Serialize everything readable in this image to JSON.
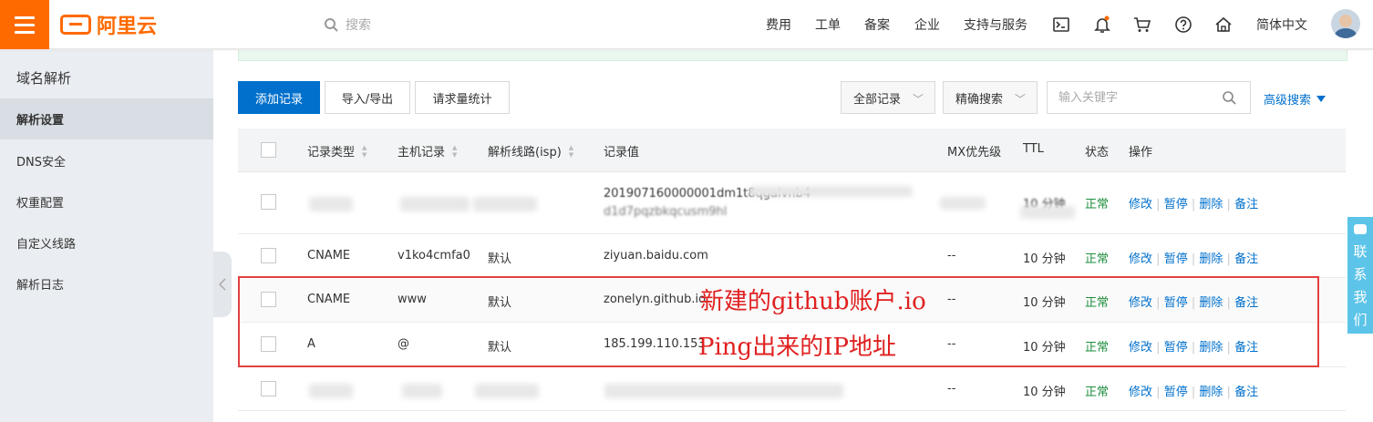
{
  "brand": {
    "name": "阿里云"
  },
  "header": {
    "search_placeholder": "搜索",
    "nav": [
      "费用",
      "工单",
      "备案",
      "企业",
      "支持与服务"
    ],
    "language": "简体中文"
  },
  "sidebar": {
    "title": "域名解析",
    "items": [
      {
        "label": "解析设置",
        "active": true
      },
      {
        "label": "DNS安全"
      },
      {
        "label": "权重配置"
      },
      {
        "label": "自定义线路"
      },
      {
        "label": "解析日志"
      }
    ]
  },
  "toolbar": {
    "add_label": "添加记录",
    "import_export_label": "导入/导出",
    "stats_label": "请求量统计",
    "filter_all": "全部记录",
    "filter_exact": "精确搜索",
    "keyword_placeholder": "输入关键字",
    "advanced_label": "高级搜索"
  },
  "table": {
    "headers": {
      "type": "记录类型",
      "host": "主机记录",
      "line": "解析线路(isp)",
      "value": "记录值",
      "mx": "MX优先级",
      "ttl": "TTL",
      "status": "状态",
      "ops": "操作"
    },
    "actions": {
      "edit": "修改",
      "pause": "暂停",
      "delete": "删除",
      "remark": "备注"
    },
    "rows": [
      {
        "type": "",
        "host": "",
        "line": "",
        "value": "201907160000001dm1t8qgalvnb4",
        "value2": "d1d7pqzbkqcusm9hl",
        "mx": "",
        "ttl": "10 分钟",
        "status": "正常"
      },
      {
        "type": "CNAME",
        "host": "v1ko4cmfa0",
        "line": "默认",
        "value": "ziyuan.baidu.com",
        "mx": "--",
        "ttl": "10 分钟",
        "status": "正常"
      },
      {
        "type": "CNAME",
        "host": "www",
        "line": "默认",
        "value": "zonelyn.github.io",
        "mx": "--",
        "ttl": "10 分钟",
        "status": "正常"
      },
      {
        "type": "A",
        "host": "@",
        "line": "默认",
        "value": "185.199.110.153",
        "mx": "--",
        "ttl": "10 分钟",
        "status": "正常"
      },
      {
        "type": "",
        "host": "",
        "line": "",
        "value": "",
        "mx": "--",
        "ttl": "10 分钟",
        "status": "正常"
      }
    ]
  },
  "annotations": {
    "note1": "新建的github账户.io",
    "note2": "Ping出来的IP地址"
  },
  "contact": {
    "label_chars": [
      "联",
      "系",
      "我",
      "们"
    ]
  },
  "colors": {
    "brand": "#ff6a00",
    "primary": "#0070cc",
    "ok": "#1e8e3e",
    "annotation": "#e02020",
    "contact": "#5cc4e8"
  }
}
